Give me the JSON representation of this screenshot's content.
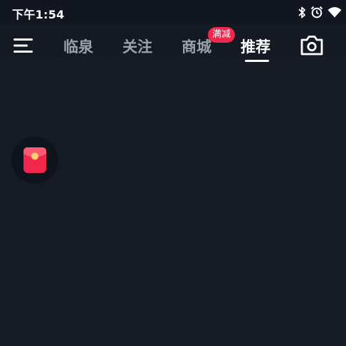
{
  "status_bar": {
    "time": "下午1:54",
    "icons": [
      "bluetooth-icon",
      "alarm-icon",
      "wifi-icon"
    ]
  },
  "nav": {
    "menu_icon": "menu-icon",
    "tabs": [
      {
        "label": "临泉",
        "active": false
      },
      {
        "label": "关注",
        "active": false
      },
      {
        "label": "商城",
        "active": false,
        "badge": "满减"
      },
      {
        "label": "推荐",
        "active": true
      }
    ],
    "camera_icon": "camera-icon"
  },
  "floating": {
    "red_packet_icon": "red-packet-icon"
  },
  "colors": {
    "background": "#151a24",
    "badge": "#f0264c",
    "inactive_tab": "#9da1a8",
    "active_tab": "#ffffff"
  }
}
